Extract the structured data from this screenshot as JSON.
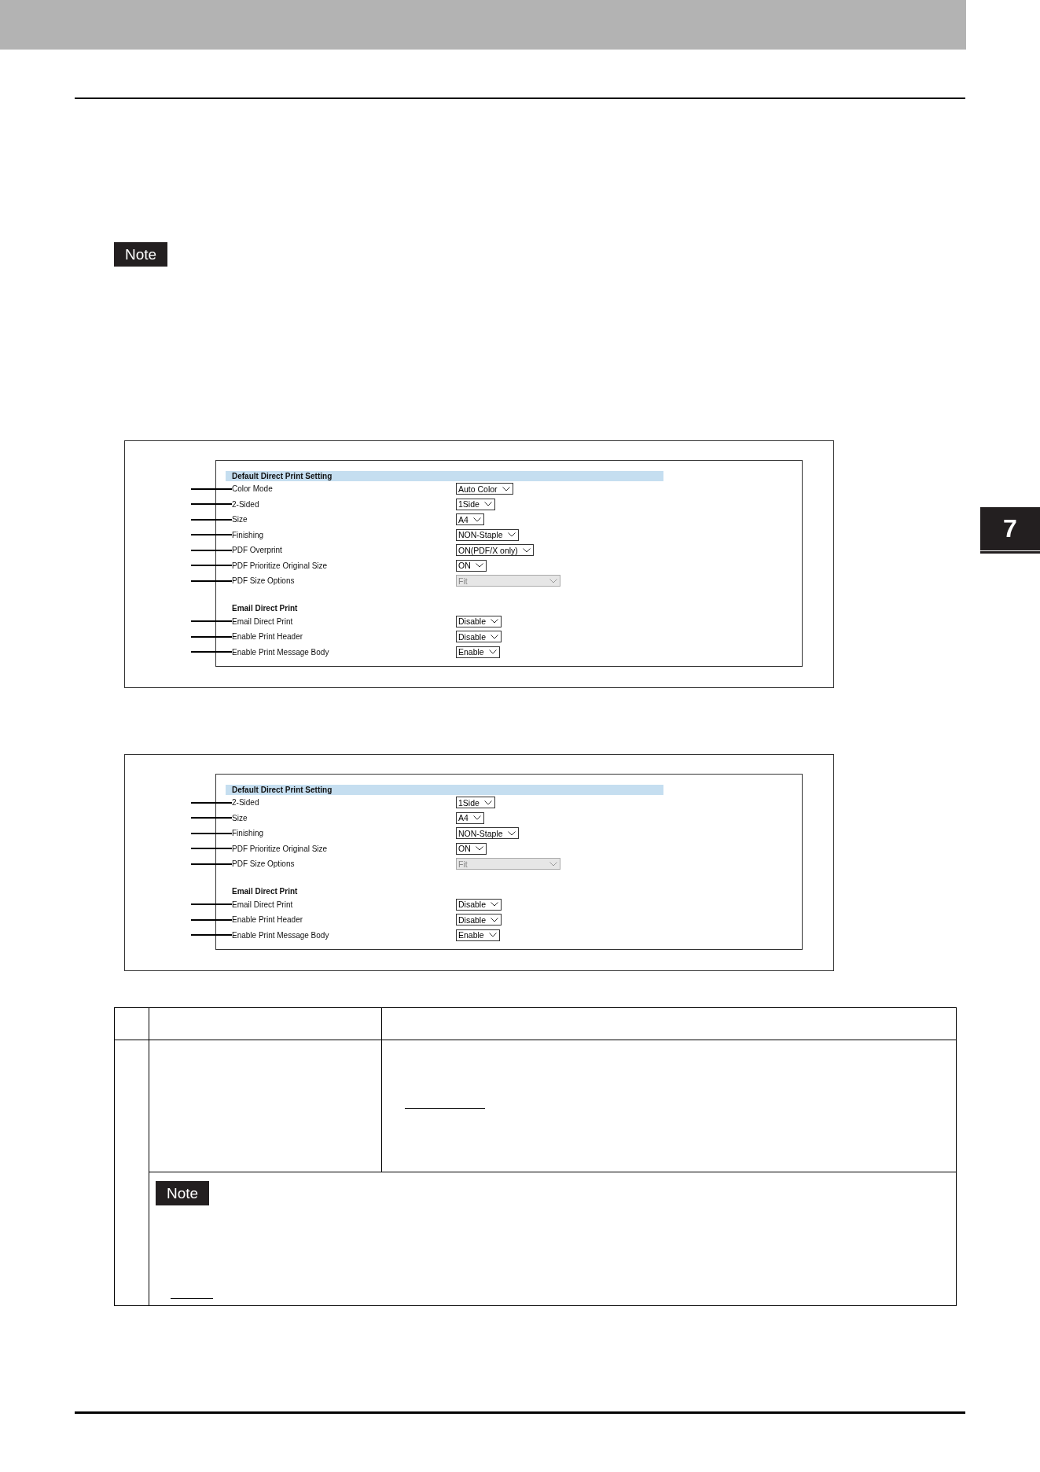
{
  "note_badge": "Note",
  "chapter_tab": "7",
  "panels": [
    {
      "header": "Default Direct Print Setting",
      "rows": [
        {
          "kind": "setting",
          "label": "Color Mode",
          "value": "Auto Color",
          "disabled": false
        },
        {
          "kind": "setting",
          "label": "2-Sided",
          "value": "1Side",
          "disabled": false
        },
        {
          "kind": "setting",
          "label": "Size",
          "value": "A4",
          "disabled": false
        },
        {
          "kind": "setting",
          "label": "Finishing",
          "value": "NON-Staple",
          "disabled": false
        },
        {
          "kind": "setting",
          "label": "PDF Overprint",
          "value": "ON(PDF/X only)",
          "disabled": false
        },
        {
          "kind": "setting",
          "label": "PDF Prioritize Original Size",
          "value": "ON",
          "disabled": false
        },
        {
          "kind": "setting",
          "label": "PDF Size Options",
          "value": "Fit",
          "disabled": true
        },
        {
          "kind": "heading",
          "label": "Email Direct Print"
        },
        {
          "kind": "setting",
          "label": "Email Direct Print",
          "value": "Disable",
          "disabled": false
        },
        {
          "kind": "setting",
          "label": "Enable Print Header",
          "value": "Disable",
          "disabled": false
        },
        {
          "kind": "setting",
          "label": "Enable Print Message Body",
          "value": "Enable",
          "disabled": false
        }
      ]
    },
    {
      "header": "Default Direct Print Setting",
      "rows": [
        {
          "kind": "setting",
          "label": "2-Sided",
          "value": "1Side",
          "disabled": false
        },
        {
          "kind": "setting",
          "label": "Size",
          "value": "A4",
          "disabled": false
        },
        {
          "kind": "setting",
          "label": "Finishing",
          "value": "NON-Staple",
          "disabled": false
        },
        {
          "kind": "setting",
          "label": "PDF Prioritize Original Size",
          "value": "ON",
          "disabled": false
        },
        {
          "kind": "setting",
          "label": "PDF Size Options",
          "value": "Fit",
          "disabled": true
        },
        {
          "kind": "heading",
          "label": "Email Direct Print"
        },
        {
          "kind": "setting",
          "label": "Email Direct Print",
          "value": "Disable",
          "disabled": false
        },
        {
          "kind": "setting",
          "label": "Enable Print Header",
          "value": "Disable",
          "disabled": false
        },
        {
          "kind": "setting",
          "label": "Enable Print Message Body",
          "value": "Enable",
          "disabled": false
        }
      ]
    }
  ],
  "table_note_badge": "Note"
}
